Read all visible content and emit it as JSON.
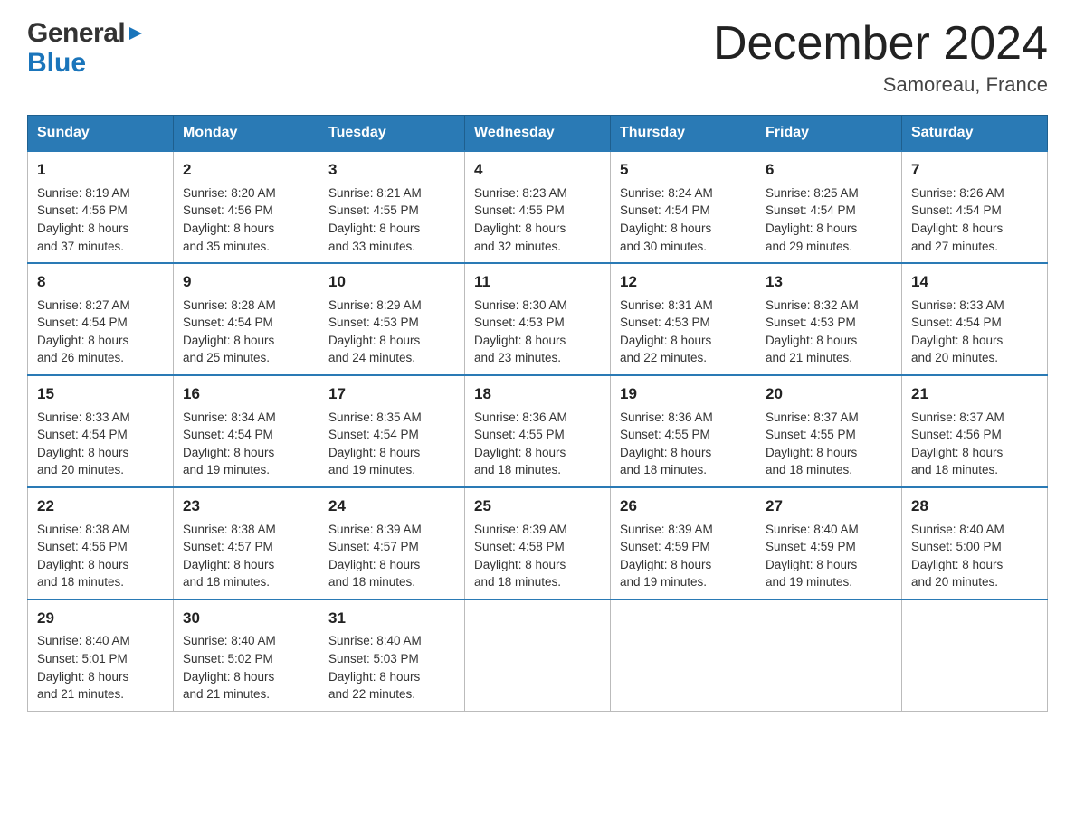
{
  "header": {
    "title": "December 2024",
    "subtitle": "Samoreau, France",
    "logo_general": "General",
    "logo_blue": "Blue"
  },
  "weekdays": [
    "Sunday",
    "Monday",
    "Tuesday",
    "Wednesday",
    "Thursday",
    "Friday",
    "Saturday"
  ],
  "weeks": [
    [
      {
        "day": "1",
        "sunrise": "8:19 AM",
        "sunset": "4:56 PM",
        "daylight": "8 hours and 37 minutes."
      },
      {
        "day": "2",
        "sunrise": "8:20 AM",
        "sunset": "4:56 PM",
        "daylight": "8 hours and 35 minutes."
      },
      {
        "day": "3",
        "sunrise": "8:21 AM",
        "sunset": "4:55 PM",
        "daylight": "8 hours and 33 minutes."
      },
      {
        "day": "4",
        "sunrise": "8:23 AM",
        "sunset": "4:55 PM",
        "daylight": "8 hours and 32 minutes."
      },
      {
        "day": "5",
        "sunrise": "8:24 AM",
        "sunset": "4:54 PM",
        "daylight": "8 hours and 30 minutes."
      },
      {
        "day": "6",
        "sunrise": "8:25 AM",
        "sunset": "4:54 PM",
        "daylight": "8 hours and 29 minutes."
      },
      {
        "day": "7",
        "sunrise": "8:26 AM",
        "sunset": "4:54 PM",
        "daylight": "8 hours and 27 minutes."
      }
    ],
    [
      {
        "day": "8",
        "sunrise": "8:27 AM",
        "sunset": "4:54 PM",
        "daylight": "8 hours and 26 minutes."
      },
      {
        "day": "9",
        "sunrise": "8:28 AM",
        "sunset": "4:54 PM",
        "daylight": "8 hours and 25 minutes."
      },
      {
        "day": "10",
        "sunrise": "8:29 AM",
        "sunset": "4:53 PM",
        "daylight": "8 hours and 24 minutes."
      },
      {
        "day": "11",
        "sunrise": "8:30 AM",
        "sunset": "4:53 PM",
        "daylight": "8 hours and 23 minutes."
      },
      {
        "day": "12",
        "sunrise": "8:31 AM",
        "sunset": "4:53 PM",
        "daylight": "8 hours and 22 minutes."
      },
      {
        "day": "13",
        "sunrise": "8:32 AM",
        "sunset": "4:53 PM",
        "daylight": "8 hours and 21 minutes."
      },
      {
        "day": "14",
        "sunrise": "8:33 AM",
        "sunset": "4:54 PM",
        "daylight": "8 hours and 20 minutes."
      }
    ],
    [
      {
        "day": "15",
        "sunrise": "8:33 AM",
        "sunset": "4:54 PM",
        "daylight": "8 hours and 20 minutes."
      },
      {
        "day": "16",
        "sunrise": "8:34 AM",
        "sunset": "4:54 PM",
        "daylight": "8 hours and 19 minutes."
      },
      {
        "day": "17",
        "sunrise": "8:35 AM",
        "sunset": "4:54 PM",
        "daylight": "8 hours and 19 minutes."
      },
      {
        "day": "18",
        "sunrise": "8:36 AM",
        "sunset": "4:55 PM",
        "daylight": "8 hours and 18 minutes."
      },
      {
        "day": "19",
        "sunrise": "8:36 AM",
        "sunset": "4:55 PM",
        "daylight": "8 hours and 18 minutes."
      },
      {
        "day": "20",
        "sunrise": "8:37 AM",
        "sunset": "4:55 PM",
        "daylight": "8 hours and 18 minutes."
      },
      {
        "day": "21",
        "sunrise": "8:37 AM",
        "sunset": "4:56 PM",
        "daylight": "8 hours and 18 minutes."
      }
    ],
    [
      {
        "day": "22",
        "sunrise": "8:38 AM",
        "sunset": "4:56 PM",
        "daylight": "8 hours and 18 minutes."
      },
      {
        "day": "23",
        "sunrise": "8:38 AM",
        "sunset": "4:57 PM",
        "daylight": "8 hours and 18 minutes."
      },
      {
        "day": "24",
        "sunrise": "8:39 AM",
        "sunset": "4:57 PM",
        "daylight": "8 hours and 18 minutes."
      },
      {
        "day": "25",
        "sunrise": "8:39 AM",
        "sunset": "4:58 PM",
        "daylight": "8 hours and 18 minutes."
      },
      {
        "day": "26",
        "sunrise": "8:39 AM",
        "sunset": "4:59 PM",
        "daylight": "8 hours and 19 minutes."
      },
      {
        "day": "27",
        "sunrise": "8:40 AM",
        "sunset": "4:59 PM",
        "daylight": "8 hours and 19 minutes."
      },
      {
        "day": "28",
        "sunrise": "8:40 AM",
        "sunset": "5:00 PM",
        "daylight": "8 hours and 20 minutes."
      }
    ],
    [
      {
        "day": "29",
        "sunrise": "8:40 AM",
        "sunset": "5:01 PM",
        "daylight": "8 hours and 21 minutes."
      },
      {
        "day": "30",
        "sunrise": "8:40 AM",
        "sunset": "5:02 PM",
        "daylight": "8 hours and 21 minutes."
      },
      {
        "day": "31",
        "sunrise": "8:40 AM",
        "sunset": "5:03 PM",
        "daylight": "8 hours and 22 minutes."
      },
      null,
      null,
      null,
      null
    ]
  ],
  "labels": {
    "sunrise": "Sunrise:",
    "sunset": "Sunset:",
    "daylight": "Daylight:"
  }
}
